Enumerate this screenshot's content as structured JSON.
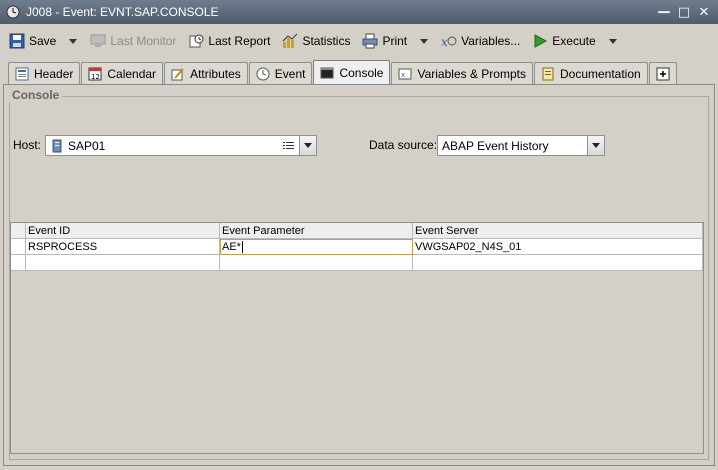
{
  "window": {
    "title": "J008 - Event: EVNT.SAP.CONSOLE",
    "controls": [
      "minimize",
      "maximize",
      "close"
    ]
  },
  "toolbar": {
    "save": "Save",
    "last_monitor": "Last Monitor",
    "last_report": "Last Report",
    "statistics": "Statistics",
    "print": "Print",
    "variables": "Variables...",
    "execute": "Execute"
  },
  "tabs": [
    {
      "label": "Header",
      "icon": "header-icon"
    },
    {
      "label": "Calendar",
      "icon": "calendar-icon"
    },
    {
      "label": "Attributes",
      "icon": "attributes-icon"
    },
    {
      "label": "Event",
      "icon": "event-icon"
    },
    {
      "label": "Console",
      "icon": "console-icon",
      "active": true
    },
    {
      "label": "Variables & Prompts",
      "icon": "variables-icon"
    },
    {
      "label": "Documentation",
      "icon": "documentation-icon"
    },
    {
      "label": "",
      "icon": "add-tab-icon"
    }
  ],
  "console": {
    "group_label": "Console",
    "host_label": "Host:",
    "host_value": "SAP01",
    "datasource_label": "Data source:",
    "datasource_value": "ABAP Event History"
  },
  "table": {
    "columns": [
      "Event ID",
      "Event Parameter",
      "Event Server"
    ],
    "rows": [
      [
        "RSPROCESS",
        "AE*",
        "VWGSAP02_N4S_01"
      ]
    ]
  }
}
